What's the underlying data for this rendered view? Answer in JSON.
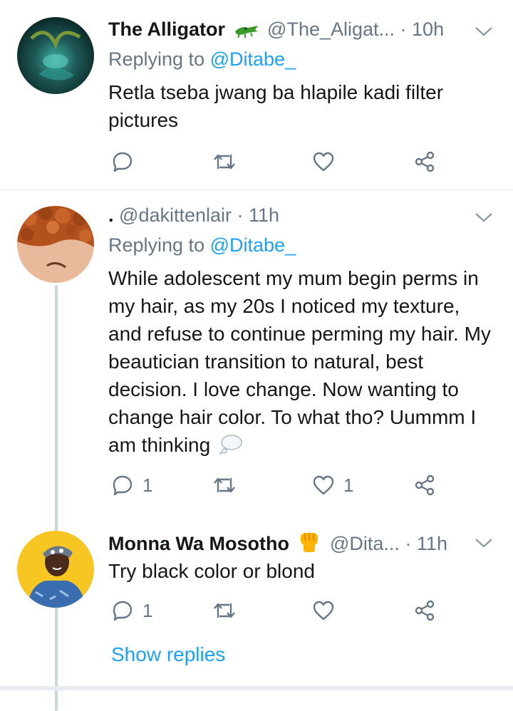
{
  "tweets": [
    {
      "name": "The Alligator",
      "name_emoji": "crocodile-emoji",
      "handle_time": "@The_Aligat... · 10h",
      "replying_prefix": "Replying to",
      "replying_handle": "@Ditabe_",
      "body": "Retla tseba jwang ba hlapile kadi filter pictures",
      "reply_count": "",
      "like_count": ""
    },
    {
      "name": ".",
      "handle_time": "@dakittenlair · 11h",
      "replying_prefix": "Replying to",
      "replying_handle": "@Ditabe_",
      "body": "While adolescent my mum begin perms in my hair, as my 20s I noticed my texture, and refuse to continue perming my hair.  My beautician transition to natural, best decision. I love change. Now wanting to change hair color.  To what tho?  Uummm I am thinking",
      "trailing_emoji": "thought-balloon-emoji",
      "reply_count": "1",
      "like_count": "1"
    },
    {
      "name": "Monna Wa Mosotho",
      "name_emoji": "raised-fist-emoji",
      "handle_time": "@Dita... · 11h",
      "body": "Try black color or blond",
      "reply_count": "1",
      "like_count": ""
    }
  ],
  "show_replies": "Show replies",
  "colors": {
    "accent": "#1da1f2",
    "secondary_text": "#657786",
    "divider": "#e1e8ed",
    "thread_line": "#ccd6dd"
  }
}
